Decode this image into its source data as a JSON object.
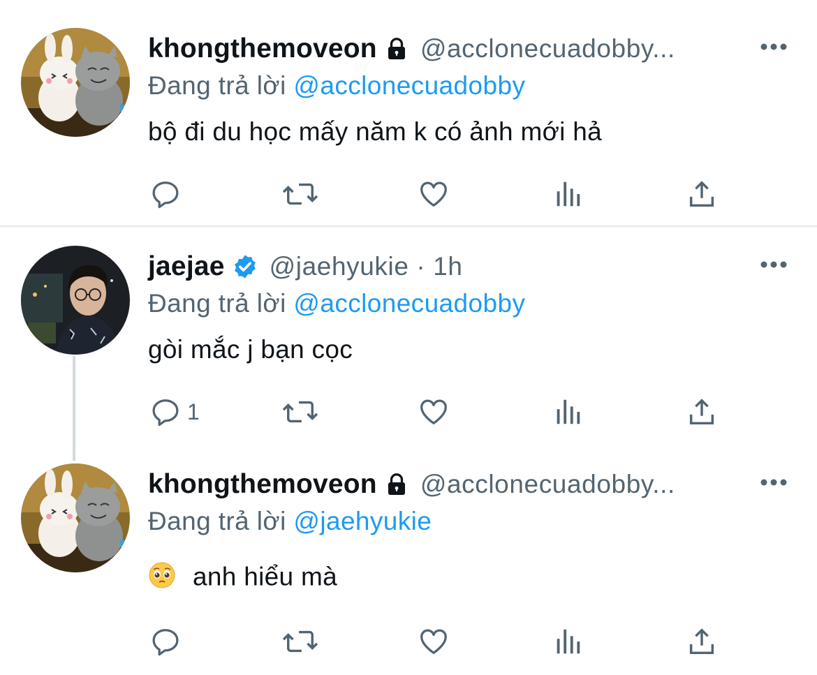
{
  "tweets": [
    {
      "name": "khongthemoveon",
      "handle": "@acclonecuadobby...",
      "badge": "lock-icon",
      "reply_prefix": "Đang trả lời",
      "reply_to": "@acclonecuadobby",
      "text": "bộ đi du học mấy năm k có ảnh mới hả",
      "reply_count": ""
    },
    {
      "name": "jaejae",
      "handle": "@jaehyukie · 1h",
      "badge": "verified-icon",
      "reply_prefix": "Đang trả lời",
      "reply_to": "@acclonecuadobby",
      "text": "gòi mắc j bạn cọc",
      "reply_count": "1"
    },
    {
      "name": "khongthemoveon",
      "handle": "@acclonecuadobby...",
      "badge": "lock-icon",
      "reply_prefix": "Đang trả lời",
      "reply_to": "@jaehyukie",
      "text": "anh hiểu mà",
      "emoji": "pleading-face-emoji",
      "reply_count": ""
    }
  ],
  "colors": {
    "link": "#1d9bf0",
    "secondary_text": "#536471",
    "primary_text": "#0f1419",
    "verified": "#1d9bf0",
    "divider": "#e6e9eb",
    "thread_line": "#cfd9de"
  },
  "action_icons": [
    "reply-icon",
    "retweet-icon",
    "like-icon",
    "analytics-icon",
    "share-icon"
  ]
}
